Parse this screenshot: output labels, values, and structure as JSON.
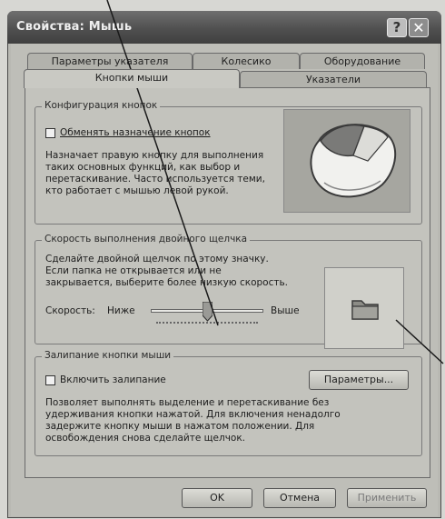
{
  "window": {
    "title": "Свойства: Мышь",
    "help_glyph": "?",
    "close_glyph": "✕"
  },
  "tabs": [
    {
      "label": "Параметры указателя"
    },
    {
      "label": "Колесико"
    },
    {
      "label": "Оборудование"
    },
    {
      "label": "Кнопки мыши"
    },
    {
      "label": "Указатели"
    }
  ],
  "button_config": {
    "group_title": "Конфигурация кнопок",
    "swap_checkbox_label": "Обменять назначение кнопок",
    "swap_checked": false,
    "description": [
      "Назначает правую кнопку для выполнения",
      "таких основных функций, как выбор и",
      "перетаскивание. Часто используется теми,",
      "кто работает с мышью левой рукой."
    ]
  },
  "double_click": {
    "group_title": "Скорость выполнения двойного щелчка",
    "description": [
      "Сделайте двойной щелчок по этому значку.",
      "Если папка не открывается или не",
      "закрывается, выберите более низкую скорость."
    ],
    "speed_label": "Скорость:",
    "slow_label": "Ниже",
    "fast_label": "Выше",
    "speed_value": 0.5
  },
  "click_lock": {
    "group_title": "Залипание кнопки мыши",
    "checkbox_label": "Включить залипание",
    "checked": false,
    "settings_button": "Параметры...",
    "description": [
      "Позволяет выполнять выделение и перетаскивание без",
      "удерживания кнопки нажатой. Для включения ненадолго",
      "задержите кнопку мыши в нажатом положении. Для",
      "освобождения снова сделайте щелчок."
    ]
  },
  "footer": {
    "ok": "OK",
    "cancel": "Отмена",
    "apply": "Применить"
  }
}
